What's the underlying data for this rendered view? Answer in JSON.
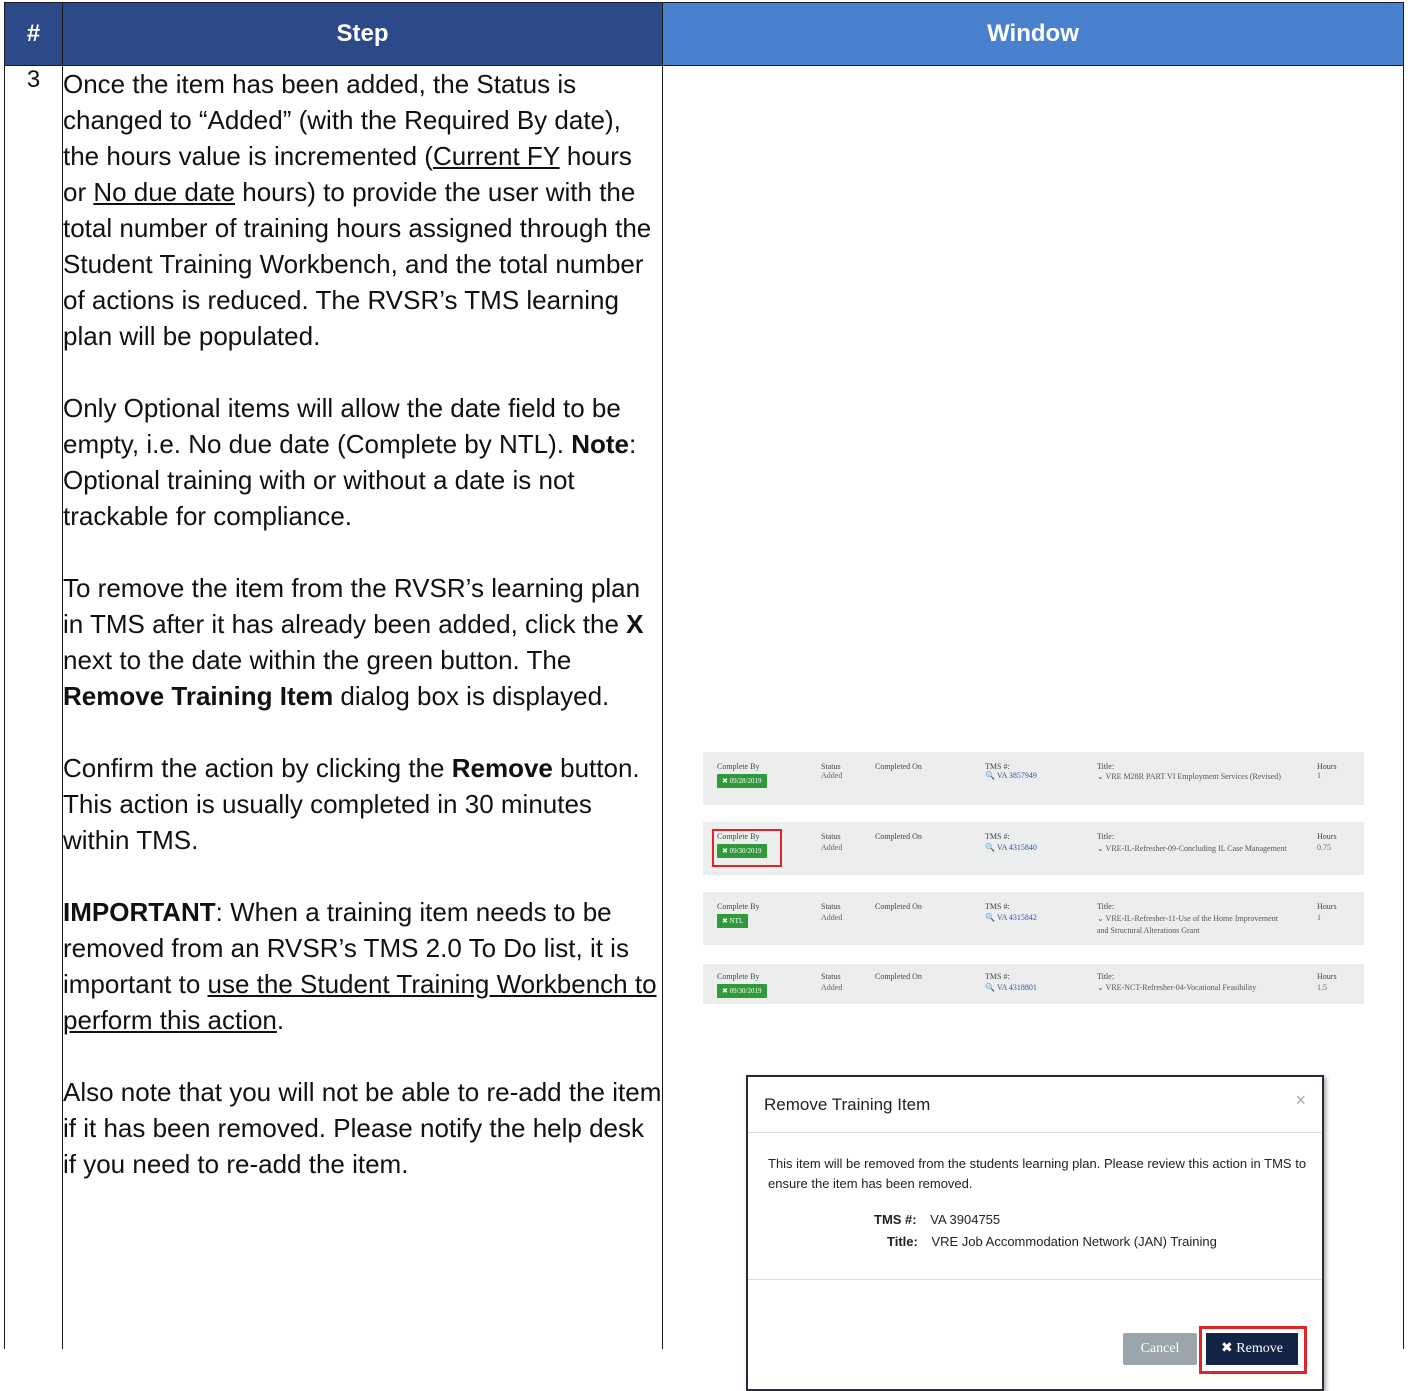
{
  "header": {
    "num": "#",
    "step": "Step",
    "window": "Window"
  },
  "row": {
    "num": "3",
    "p1": {
      "a": "Once the item has been added, the Status is changed to “Added” (with the Required By date), the hours value is incremented (",
      "u1": "Current FY",
      "b": " hours or ",
      "u2": "No due date",
      "c": " hours) to provide the user with the total number of training hours assigned through the Student Training Workbench, and the total number of actions is reduced. The RVSR’s TMS learning plan will be populated."
    },
    "p2": {
      "a": "Only Optional items will allow the date field to be empty, i.e. No due date (Complete by NTL).",
      "b_bold": "Note",
      "c": ": Optional training with or without a date is not trackable for compliance."
    },
    "p3": {
      "a": "To remove the item from the RVSR’s learning plan in TMS after it has already been added, click the ",
      "x": "X",
      "b": " next to the date within the green button. The ",
      "bold": "Remove Training Item",
      "c": " dialog box is displayed."
    },
    "p4": {
      "a": "Confirm the action by clicking the ",
      "bold": "Remove",
      "b": " button. This action is usually completed in 30 minutes within TMS."
    },
    "p5": {
      "bold": "IMPORTANT",
      "a": ":  When a training item needs to be removed from an RVSR’s TMS 2.0 To Do list, it is important to ",
      "u": "use the Student Training Workbench to perform this action",
      "b": "."
    },
    "p6": "Also note that you will not be able to re-add the item if it has been removed. Please notify the help desk if you need to re-add the item."
  },
  "list": {
    "labels": {
      "complete_by": "Complete By",
      "status": "Status",
      "completed_on": "Completed On",
      "tms": "TMS #:",
      "title": "Title:",
      "hours": "Hours"
    },
    "items": [
      {
        "chip": "✖ 09/28/2019",
        "status": "Added",
        "tms": "🔍 VA 3857949",
        "title": "⌄ VRE M28R PART VI Employment Services (Revised)",
        "hours": "1"
      },
      {
        "chip": "✖ 09/30/2019",
        "status": "Added",
        "tms": "🔍 VA 4315840",
        "title": "⌄ VRE-IL-Refresher-09-Concluding IL Case Management",
        "hours": "0.75"
      },
      {
        "chip": "✖ NTL",
        "status": "Added",
        "tms": "🔍 VA 4315842",
        "title": "⌄ VRE-IL-Refresher-11-Use of the Home Improvement and Structural Alterations Grant",
        "hours": "1"
      },
      {
        "chip": "✖ 09/30/2019",
        "status": "Added",
        "tms": "🔍 VA 4318801",
        "title": "⌄ VRE-NCT-Refresher-04-Vocational Feasibility",
        "hours": "1.5"
      }
    ]
  },
  "dialog": {
    "title": "Remove Training Item",
    "close": "×",
    "message": "This item will be removed from the students learning plan. Please review this action in TMS to ensure the item has been removed.",
    "tms_label": "TMS #:",
    "tms_value": "VA 3904755",
    "title_label": "Title:",
    "title_value": "VRE Job Accommodation Network (JAN) Training",
    "cancel": "Cancel",
    "remove": "✖ Remove"
  }
}
